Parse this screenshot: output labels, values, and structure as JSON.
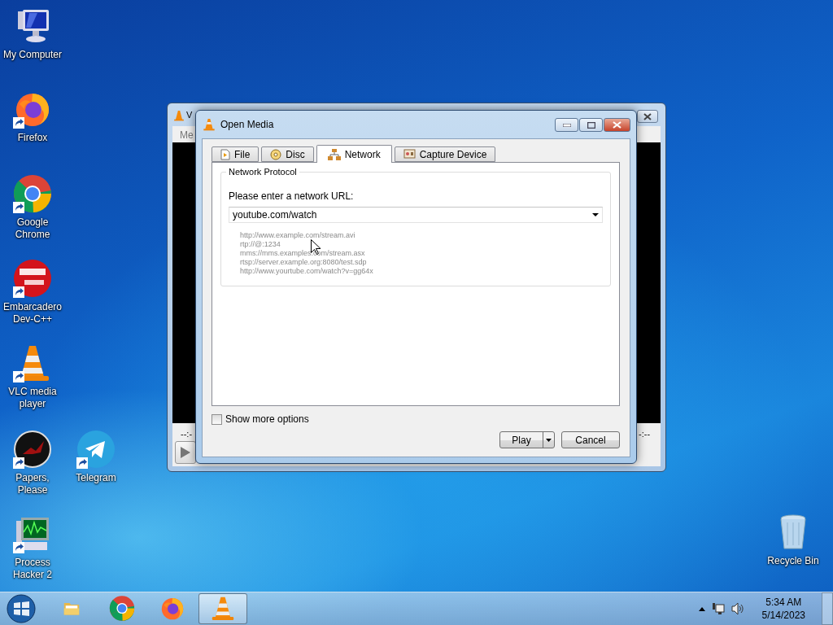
{
  "desktop_icons": [
    {
      "label": "My Computer",
      "kind": "computer",
      "shortcut": false
    },
    {
      "label": "Firefox",
      "kind": "firefox",
      "shortcut": true
    },
    {
      "label": "Google Chrome",
      "kind": "chrome",
      "shortcut": true
    },
    {
      "label": "Embarcadero Dev-C++",
      "kind": "devcpp",
      "shortcut": true
    },
    {
      "label": "VLC media player",
      "kind": "vlc",
      "shortcut": true
    },
    {
      "label": "Papers, Please",
      "kind": "papers",
      "shortcut": true
    },
    {
      "label": "Telegram",
      "kind": "telegram",
      "shortcut": true
    },
    {
      "label": "Process Hacker 2",
      "kind": "monitor",
      "shortcut": true
    },
    {
      "label": "Recycle Bin",
      "kind": "bin",
      "shortcut": false
    }
  ],
  "background_window": {
    "title": "V",
    "menu": "Me",
    "elapsed": "--:-",
    "total": "-:--"
  },
  "dialog": {
    "title": "Open Media",
    "tabs": [
      {
        "label": "File",
        "kind": "file",
        "selected": false
      },
      {
        "label": "Disc",
        "kind": "disc",
        "selected": false
      },
      {
        "label": "Network",
        "kind": "network",
        "selected": true
      },
      {
        "label": "Capture Device",
        "kind": "capture",
        "selected": false
      }
    ],
    "group_title": "Network Protocol",
    "prompt": "Please enter a network URL:",
    "url_value": "youtube.com/watch",
    "examples": [
      "http://www.example.com/stream.avi",
      "rtp://@:1234",
      "mms://mms.examples.com/stream.asx",
      "rtsp://server.example.org:8080/test.sdp",
      "http://www.yourtube.com/watch?v=gg64x"
    ],
    "show_more_options": {
      "label": "Show more options",
      "checked": false
    },
    "buttons": [
      {
        "label": "Play",
        "kind": "split"
      },
      {
        "label": "Cancel",
        "kind": "plain"
      }
    ]
  },
  "taskbar": {
    "items": [
      {
        "kind": "explorer",
        "selected": false
      },
      {
        "kind": "chrome",
        "selected": false
      },
      {
        "kind": "firefox",
        "selected": false
      },
      {
        "kind": "vlc",
        "selected": true
      }
    ],
    "time": "5:34 AM",
    "date": "5/14/2023"
  }
}
